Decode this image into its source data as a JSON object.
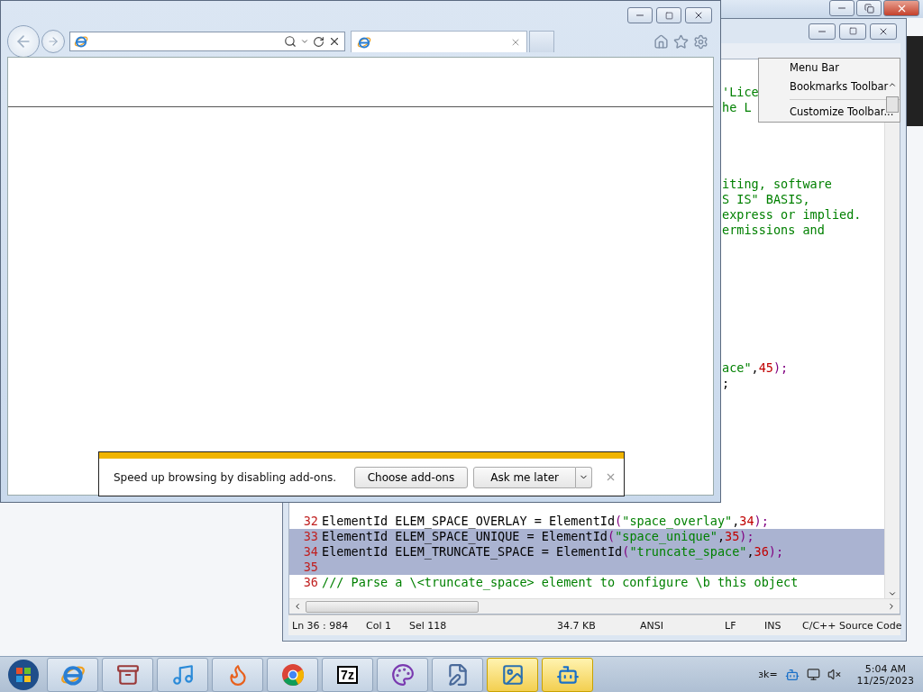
{
  "editor": {
    "code_lines": [
      {
        "kind": "blank"
      },
      {
        "kind": "clipped",
        "tokens": [
          {
            "t": "'Lice",
            "kind": "comment"
          }
        ]
      },
      {
        "kind": "clipped",
        "tokens": [
          {
            "t": "he L",
            "kind": "comment"
          }
        ]
      },
      {
        "kind": "blank"
      },
      {
        "kind": "blank"
      },
      {
        "kind": "blank"
      },
      {
        "kind": "blank"
      },
      {
        "kind": "clipped",
        "tokens": [
          {
            "t": "iting, software",
            "kind": "comment"
          }
        ]
      },
      {
        "kind": "clipped",
        "tokens": [
          {
            "t": "S IS\" BASIS,",
            "kind": "comment"
          }
        ]
      },
      {
        "kind": "clipped",
        "tokens": [
          {
            "t": "express or implied.",
            "kind": "comment"
          }
        ]
      },
      {
        "kind": "clipped",
        "tokens": [
          {
            "t": "ermissions and",
            "kind": "comment"
          }
        ]
      },
      {
        "kind": "blank"
      },
      {
        "kind": "blank"
      },
      {
        "kind": "blank"
      },
      {
        "kind": "blank"
      },
      {
        "kind": "blank"
      },
      {
        "kind": "blank"
      },
      {
        "kind": "blank"
      },
      {
        "kind": "blank"
      },
      {
        "kind": "clipped",
        "tokens": [
          {
            "t": "ace\"",
            "kind": "string"
          },
          {
            "t": ",",
            "kind": "plain"
          },
          {
            "t": "45",
            "kind": "number"
          },
          {
            "t": ");",
            "kind": "punct"
          }
        ]
      },
      {
        "kind": "clipped",
        "tokens": [
          {
            "t": ";",
            "kind": "plain"
          }
        ]
      },
      {
        "kind": "blank"
      },
      {
        "kind": "blank"
      },
      {
        "kind": "blank"
      },
      {
        "kind": "blank"
      },
      {
        "kind": "blank"
      },
      {
        "kind": "blank"
      },
      {
        "kind": "blank"
      },
      {
        "kind": "blank"
      },
      {
        "kind": "full",
        "number": "32",
        "selected": false,
        "tokens": [
          {
            "t": "ElementId ELEM_SPACE_OVERLAY = ElementId",
            "kind": "plain"
          },
          {
            "t": "(",
            "kind": "punct"
          },
          {
            "t": "\"space_overlay\"",
            "kind": "string"
          },
          {
            "t": ",",
            "kind": "plain"
          },
          {
            "t": "34",
            "kind": "number"
          },
          {
            "t": ");",
            "kind": "punct"
          }
        ]
      },
      {
        "kind": "full",
        "number": "33",
        "selected": true,
        "tokens": [
          {
            "t": "ElementId ELEM_SPACE_UNIQUE = ElementId",
            "kind": "plain"
          },
          {
            "t": "(",
            "kind": "punct"
          },
          {
            "t": "\"space_unique\"",
            "kind": "string"
          },
          {
            "t": ",",
            "kind": "plain"
          },
          {
            "t": "35",
            "kind": "number"
          },
          {
            "t": ");",
            "kind": "punct"
          }
        ]
      },
      {
        "kind": "full",
        "number": "34",
        "selected": true,
        "tokens": [
          {
            "t": "ElementId ELEM_TRUNCATE_SPACE = ElementId",
            "kind": "plain"
          },
          {
            "t": "(",
            "kind": "punct"
          },
          {
            "t": "\"truncate_space\"",
            "kind": "string"
          },
          {
            "t": ",",
            "kind": "plain"
          },
          {
            "t": "36",
            "kind": "number"
          },
          {
            "t": ");",
            "kind": "punct"
          }
        ]
      },
      {
        "kind": "full",
        "number": "35",
        "selected": true
      },
      {
        "kind": "full",
        "number": "36",
        "selected": false,
        "tokens": [
          {
            "t": "/// Parse a \\<truncate_space> element to configure \\b this object",
            "kind": "comment"
          }
        ]
      }
    ],
    "menu": [
      {
        "kind": "item",
        "label": "Menu Bar"
      },
      {
        "kind": "item",
        "label": "Bookmarks Toolbar"
      },
      {
        "kind": "separator"
      },
      {
        "kind": "item",
        "label": "Customize Toolbar..."
      }
    ],
    "status_bar": [
      "Ln 36 : 984",
      "Col 1",
      "Sel 118",
      "34.7 KB",
      "ANSI",
      "LF",
      "INS",
      "C/C++ Source Code"
    ]
  },
  "browser": {
    "notification": {
      "message": "Speed up browsing by disabling add-ons.",
      "buttons": [
        "Choose add-ons",
        "Ask me later"
      ]
    }
  },
  "taskbar": {
    "items": [
      {
        "kind": "browser",
        "highlighted": false
      },
      {
        "kind": "archive",
        "highlighted": false
      },
      {
        "kind": "music",
        "highlighted": false
      },
      {
        "kind": "fox",
        "highlighted": false
      },
      {
        "kind": "chrome",
        "highlighted": false
      },
      {
        "kind": "label",
        "label": "7z",
        "highlighted": false
      },
      {
        "kind": "paint",
        "highlighted": false
      },
      {
        "kind": "editor",
        "highlighted": false
      },
      {
        "kind": "picture",
        "highlighted": true
      },
      {
        "kind": "robot",
        "highlighted": true
      }
    ],
    "tray_text": "ɜk=",
    "time": "5:04 AM",
    "date": "11/25/2023"
  }
}
